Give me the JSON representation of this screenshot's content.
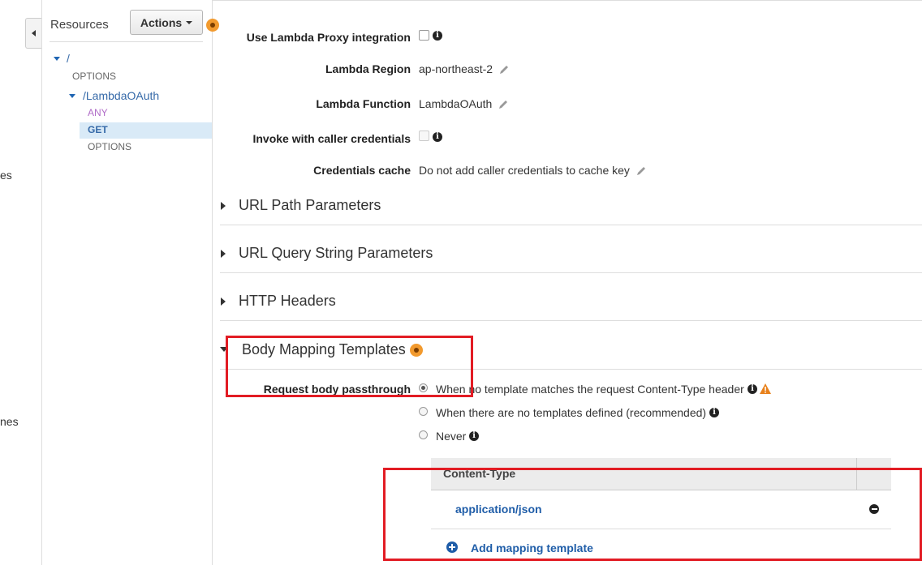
{
  "left_strip": {
    "fragment1": "es",
    "fragment2": "nes"
  },
  "resources": {
    "title": "Resources",
    "actions_label": "Actions",
    "tree": [
      {
        "label": "/",
        "kind": "path"
      },
      {
        "label": "OPTIONS",
        "kind": "method"
      },
      {
        "label": "/LambdaOAuth",
        "kind": "path"
      },
      {
        "label": "ANY",
        "kind": "method",
        "color": "#b06cc7"
      },
      {
        "label": "GET",
        "kind": "method",
        "selected": true
      },
      {
        "label": "OPTIONS",
        "kind": "method"
      }
    ]
  },
  "integration": {
    "proxy_label": "Use Lambda Proxy integration",
    "region_label": "Lambda Region",
    "region_value": "ap-northeast-2",
    "function_label": "Lambda Function",
    "function_value": "LambdaOAuth",
    "invoke_label": "Invoke with caller credentials",
    "cache_label": "Credentials cache",
    "cache_value": "Do not add caller credentials to cache key"
  },
  "sections": {
    "url_path": "URL Path Parameters",
    "url_query": "URL Query String Parameters",
    "http_headers": "HTTP Headers",
    "body_mapping": "Body Mapping Templates"
  },
  "body_mapping": {
    "passthrough_label": "Request body passthrough",
    "options": [
      "When no template matches the request Content-Type header",
      "When there are no templates defined (recommended)",
      "Never"
    ],
    "selected_option": 0,
    "table_header": "Content-Type",
    "rows": [
      "application/json"
    ],
    "add_label": "Add mapping template"
  },
  "colors": {
    "accent_orange": "#f29a2e",
    "annotation_red": "#e21c24",
    "link_blue": "#1f5da8",
    "warning": "#e8811c"
  }
}
